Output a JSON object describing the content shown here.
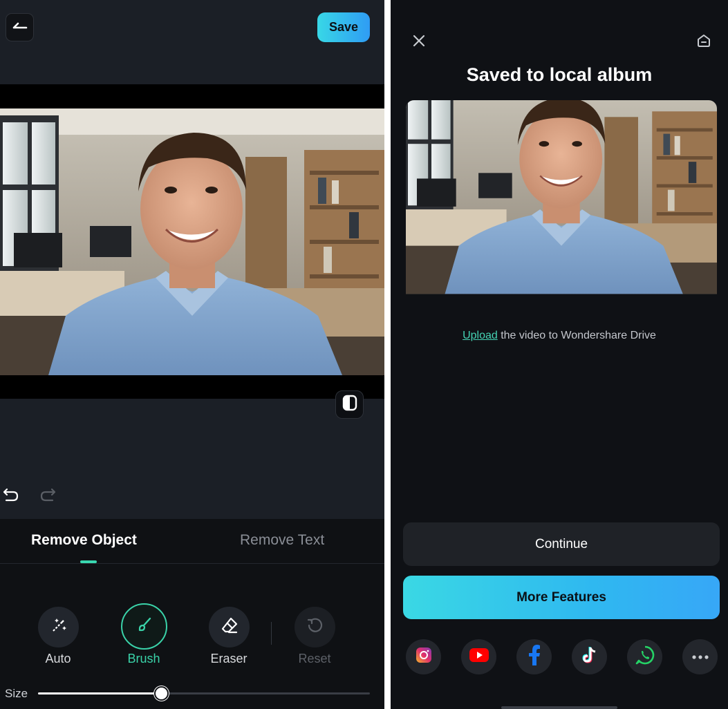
{
  "editor": {
    "save_label": "Save",
    "tabs": [
      {
        "label": "Remove Object",
        "active": true
      },
      {
        "label": "Remove Text",
        "active": false
      }
    ],
    "tools": [
      {
        "label": "Auto",
        "icon": "magic-wand-icon"
      },
      {
        "label": "Brush",
        "icon": "brush-icon",
        "active": true
      },
      {
        "label": "Eraser",
        "icon": "eraser-icon"
      },
      {
        "label": "Reset",
        "icon": "reset-icon",
        "disabled": true
      }
    ],
    "size_label": "Size",
    "size_value": 0.37,
    "icons": [
      "back-arrow-icon",
      "compare-icon",
      "undo-icon",
      "redo-icon"
    ]
  },
  "saved_dialog": {
    "title": "Saved to local album",
    "upload_link": "Upload",
    "upload_text": " the video to Wondershare Drive",
    "continue_label": "Continue",
    "more_features_label": "More Features",
    "share_targets": [
      "instagram-icon",
      "youtube-icon",
      "facebook-icon",
      "tiktok-icon",
      "whatsapp-icon",
      "more-icon"
    ],
    "icons": [
      "close-icon",
      "drive-icon"
    ]
  },
  "colors": {
    "accent": "#3ad3a9",
    "save_gradient": [
      "#38d7e6",
      "#2f9cf4"
    ],
    "more_gradient": [
      "#3ad8e4",
      "#37a7f7"
    ],
    "panel_bg": "#1b1f26",
    "dialog_bg": "#0f1115"
  }
}
